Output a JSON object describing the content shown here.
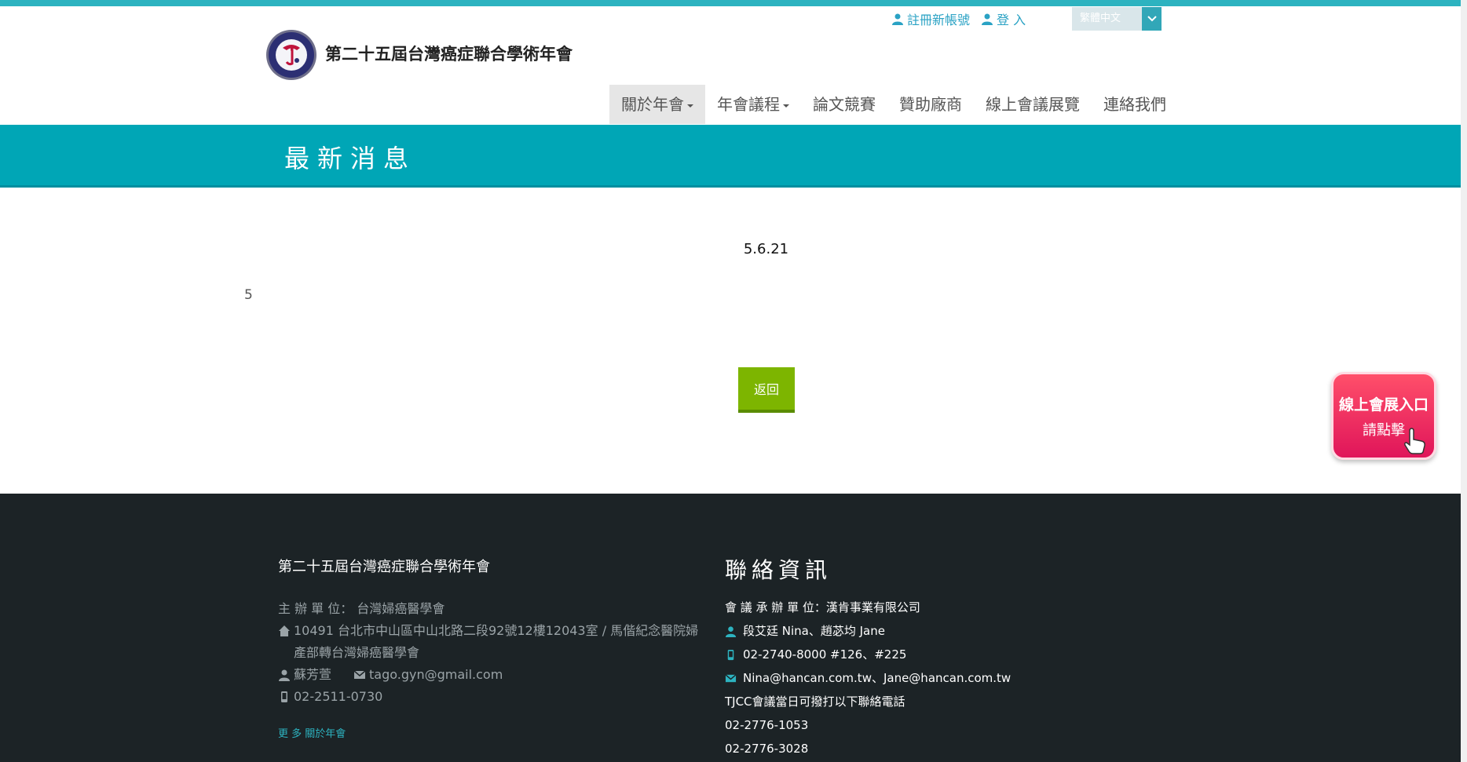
{
  "header": {
    "register_label": "註冊新帳號",
    "login_label": "登 入",
    "language": "繁體中文",
    "site_title": "第二十五屆台灣癌症聯合學術年會"
  },
  "nav": [
    {
      "label": "關於年會",
      "dropdown": true,
      "active": true
    },
    {
      "label": "年會議程",
      "dropdown": true,
      "active": false
    },
    {
      "label": "論文競賽",
      "dropdown": false,
      "active": false
    },
    {
      "label": "贊助廠商",
      "dropdown": false,
      "active": false
    },
    {
      "label": "線上會議展覽",
      "dropdown": false,
      "active": false
    },
    {
      "label": "連絡我們",
      "dropdown": false,
      "active": false
    }
  ],
  "banner": {
    "title": "最新消息"
  },
  "article": {
    "title": "5.6.21",
    "body": "5",
    "back_label": "返回"
  },
  "expo_button": {
    "line1": "線上會展入口",
    "line2": "請點擊"
  },
  "footer": {
    "left": {
      "title": "第二十五屆台灣癌症聯合學術年會",
      "organizer": "主 辦 單 位： 台灣婦癌醫學會",
      "address": "10491 台北市中山區中山北路二段92號12樓12043室 / 馬偕紀念醫院婦產部轉台灣婦癌醫學會",
      "contact_name": "蘇芳萱",
      "email": "tago.gyn@gmail.com",
      "phone": "02-2511-0730",
      "more_label": "更 多 關於年會"
    },
    "right": {
      "title": "聯絡資訊",
      "organizer": "會 議 承 辦 單 位：漢肯事業有限公司",
      "contacts": "段艾廷 Nina、趙苾均 Jane",
      "phone": "02-2740-8000 #126、#225",
      "emails": "Nina@hancan.com.tw、Jane@hancan.com.tw",
      "note": "TJCC會議當日可撥打以下聯絡電話",
      "phone2": "02-2776-1053",
      "phone3": "02-2776-3028"
    }
  },
  "colors": {
    "accent": "#00a6b6",
    "button": "#7db500",
    "footer_bg": "#1c2326",
    "expo": "#e0155a"
  }
}
